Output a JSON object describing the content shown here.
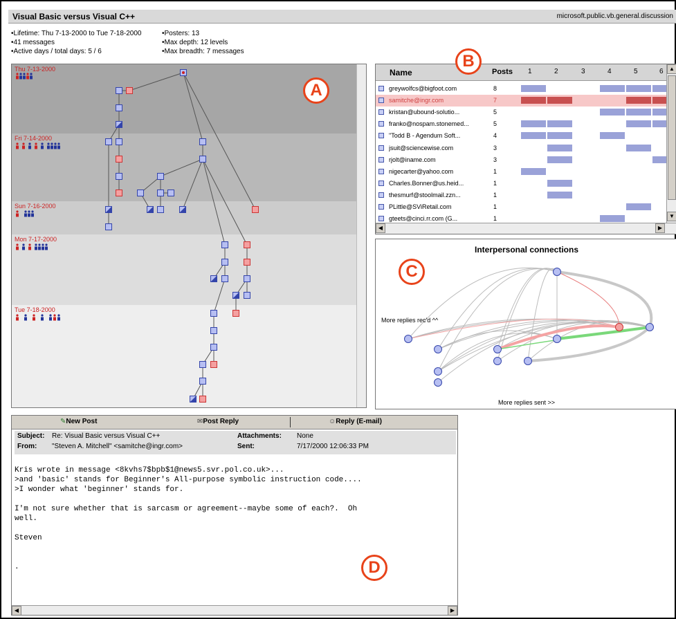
{
  "window": {
    "title": "Visual Basic versus Visual C++",
    "newsgroup": "microsoft.public.vb.general.discussion"
  },
  "stats": {
    "left": [
      "Lifetime: Thu 7-13-2000 to Tue 7-18-2000",
      "41 messages",
      "Active days / total days: 5 / 6"
    ],
    "right": [
      "Posters: 13",
      "Max depth: 12 levels",
      "Max breadth: 7 messages"
    ]
  },
  "days": [
    {
      "label": "Thu 7-13-2000",
      "people": "••••\n••••"
    },
    {
      "label": "Fri 7-14-2000",
      "people": "• • • • • • •••"
    },
    {
      "label": "Sun 7-16-2000",
      "people": "•  •••"
    },
    {
      "label": "Mon 7-17-2000",
      "people": "• • ••••"
    },
    {
      "label": "Tue 7-18-2000",
      "people": "•  •  •  •  ••"
    }
  ],
  "posters": {
    "headers": {
      "name": "Name",
      "posts": "Posts",
      "days": [
        "1",
        "2",
        "3",
        "4",
        "5",
        "6"
      ]
    },
    "rows": [
      {
        "name": "greywolfcs@bigfoot.com",
        "posts": "8",
        "days": [
          1,
          0,
          0,
          1,
          1,
          1
        ],
        "selected": false
      },
      {
        "name": "samitche@ingr.com",
        "posts": "7",
        "days": [
          1,
          1,
          0,
          0,
          1,
          1
        ],
        "selected": true
      },
      {
        "name": "kristan@ubound-solutio...",
        "posts": "5",
        "days": [
          0,
          0,
          0,
          1,
          1,
          1
        ],
        "selected": false
      },
      {
        "name": "franko@nospam.stonemed...",
        "posts": "5",
        "days": [
          1,
          1,
          0,
          0,
          1,
          1
        ],
        "selected": false
      },
      {
        "name": "\"Todd B - Agendum Soft...",
        "posts": "4",
        "days": [
          1,
          1,
          0,
          1,
          0,
          0
        ],
        "selected": false
      },
      {
        "name": "jsuit@sciencewise.com",
        "posts": "3",
        "days": [
          0,
          1,
          0,
          0,
          1,
          0
        ],
        "selected": false
      },
      {
        "name": "rjolt@iname.com",
        "posts": "3",
        "days": [
          0,
          1,
          0,
          0,
          0,
          1
        ],
        "selected": false
      },
      {
        "name": "nigecarter@yahoo.com",
        "posts": "1",
        "days": [
          1,
          0,
          0,
          0,
          0,
          0
        ],
        "selected": false
      },
      {
        "name": "Charles.Bonner@us.heid...",
        "posts": "1",
        "days": [
          0,
          1,
          0,
          0,
          0,
          0
        ],
        "selected": false
      },
      {
        "name": "thesmurf@stoolmail.zzn...",
        "posts": "1",
        "days": [
          0,
          1,
          0,
          0,
          0,
          0
        ],
        "selected": false
      },
      {
        "name": "PLittle@SViRetail.com",
        "posts": "1",
        "days": [
          0,
          0,
          0,
          0,
          1,
          0
        ],
        "selected": false
      },
      {
        "name": "gteets@cinci.rr.com (G...",
        "posts": "1",
        "days": [
          0,
          0,
          0,
          1,
          0,
          0
        ],
        "selected": false
      }
    ]
  },
  "connections": {
    "title": "Interpersonal connections",
    "recd_label": "More replies rec'd ^^",
    "sent_label": "More replies sent >>"
  },
  "message": {
    "toolbar": {
      "new_post": "New Post",
      "post_reply": "Post Reply",
      "reply_email": "Reply (E-mail)"
    },
    "labels": {
      "subject": "Subject:",
      "from": "From:",
      "attachments": "Attachments:",
      "sent": "Sent:"
    },
    "subject": "Re: Visual Basic versus Visual C++",
    "from": "\"Steven A. Mitchell\" <samitche@ingr.com>",
    "attachments": "None",
    "sent": "7/17/2000 12:06:33 PM",
    "body": [
      "Kris wrote in message <8kvhs7$bpb$1@news5.svr.pol.co.uk>...",
      ">and 'basic' stands for Beginner's All-purpose symbolic instruction code....",
      ">I wonder what 'beginner' stands for.",
      "",
      "I'm not sure whether that is sarcasm or agreement--maybe some of each?.  Oh",
      "well.",
      "",
      "Steven",
      "",
      "",
      "."
    ]
  },
  "callouts": {
    "a": "A",
    "b": "B",
    "c": "C",
    "d": "D"
  },
  "colors": {
    "accent": "#e8431a",
    "node_blue": "#9aa2d8",
    "node_red": "#f4a0a0",
    "selected_bar": "#c85050"
  }
}
